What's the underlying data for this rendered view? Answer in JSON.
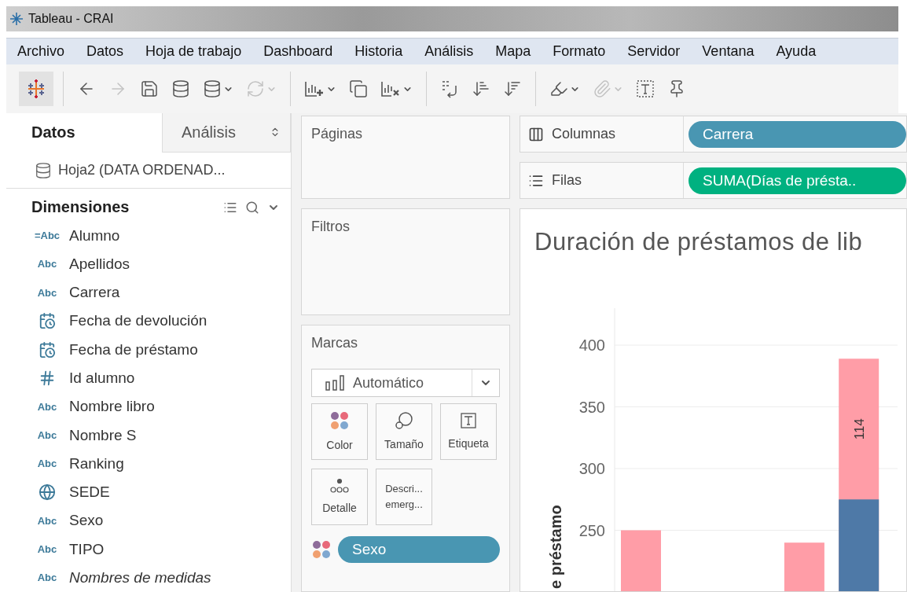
{
  "window": {
    "title": "Tableau - CRAI"
  },
  "menu": [
    "Archivo",
    "Datos",
    "Hoja de trabajo",
    "Dashboard",
    "Historia",
    "Análisis",
    "Mapa",
    "Formato",
    "Servidor",
    "Ventana",
    "Ayuda"
  ],
  "toolbar": [
    {
      "kind": "logo",
      "menu": false
    },
    {
      "kind": "sep"
    },
    {
      "kind": "back",
      "disabled": false,
      "menu": false
    },
    {
      "kind": "forward",
      "disabled": true,
      "menu": false
    },
    {
      "kind": "save",
      "disabled": false,
      "menu": false
    },
    {
      "kind": "new-source",
      "disabled": false,
      "menu": false
    },
    {
      "kind": "pause-source",
      "disabled": false,
      "menu": true
    },
    {
      "kind": "refresh",
      "disabled": true,
      "menu": true
    },
    {
      "kind": "sep"
    },
    {
      "kind": "new-sheet",
      "disabled": false,
      "menu": true
    },
    {
      "kind": "duplicate",
      "disabled": false,
      "menu": false
    },
    {
      "kind": "clear",
      "disabled": false,
      "menu": true
    },
    {
      "kind": "sep"
    },
    {
      "kind": "swap",
      "disabled": false,
      "menu": false
    },
    {
      "kind": "sort-asc",
      "disabled": false,
      "menu": false
    },
    {
      "kind": "sort-desc",
      "disabled": false,
      "menu": false
    },
    {
      "kind": "sep"
    },
    {
      "kind": "highlight",
      "disabled": false,
      "menu": true
    },
    {
      "kind": "attach",
      "disabled": true,
      "menu": true
    },
    {
      "kind": "text",
      "disabled": false,
      "menu": false
    },
    {
      "kind": "pin",
      "disabled": false,
      "menu": false
    }
  ],
  "side_tabs": [
    {
      "label": "Datos",
      "selected": true
    },
    {
      "label": "Análisis",
      "selected": false
    }
  ],
  "data_source": "Hoja2 (DATA ORDENAD...",
  "dimensions": {
    "title": "Dimensiones",
    "fields": [
      {
        "kind": "text",
        "type_label": "=Abc",
        "name": "Alumno"
      },
      {
        "kind": "text",
        "type_label": "Abc",
        "name": "Apellidos"
      },
      {
        "kind": "text",
        "type_label": "Abc",
        "name": "Carrera"
      },
      {
        "kind": "date",
        "name": "Fecha de devolución"
      },
      {
        "kind": "date",
        "name": "Fecha de préstamo"
      },
      {
        "kind": "number",
        "name": "Id alumno"
      },
      {
        "kind": "text",
        "type_label": "Abc",
        "name": "Nombre libro"
      },
      {
        "kind": "text",
        "type_label": "Abc",
        "name": "Nombre S"
      },
      {
        "kind": "text",
        "type_label": "Abc",
        "name": "Ranking"
      },
      {
        "kind": "geo",
        "name": "SEDE"
      },
      {
        "kind": "text",
        "type_label": "Abc",
        "name": "Sexo"
      },
      {
        "kind": "text",
        "type_label": "Abc",
        "name": "TIPO"
      },
      {
        "kind": "names",
        "type_label": "Abc",
        "name": "Nombres de medidas"
      }
    ]
  },
  "cards": {
    "pages": "Páginas",
    "filters": "Filtros",
    "marks": "Marcas"
  },
  "mark_type": "Automático",
  "mark_buttons": [
    {
      "kind": "color",
      "lines": [
        "Color"
      ]
    },
    {
      "kind": "size",
      "lines": [
        "Tamaño"
      ]
    },
    {
      "kind": "label",
      "lines": [
        "Etiqueta"
      ]
    },
    {
      "kind": "detail",
      "lines": [
        "Detalle"
      ]
    },
    {
      "kind": "tooltip",
      "lines": [
        "Descri...",
        "emerg..."
      ]
    }
  ],
  "mark_fields": [
    {
      "kind": "dimension",
      "label": "Sexo"
    }
  ],
  "shelves": [
    {
      "kind": "columns",
      "label": "Columnas",
      "pill": {
        "label": "Carrera",
        "kind": "dimension"
      }
    },
    {
      "kind": "rows",
      "label": "Filas",
      "pill": {
        "label": "SUMA(Días de présta..",
        "kind": "measure"
      }
    }
  ],
  "view": {
    "title": "Duración de préstamos de lib",
    "chart_data": {
      "type": "bar",
      "stacked": false,
      "grid": true,
      "ylabel": "e préstamo",
      "ylim": [
        200,
        430
      ],
      "yticks": [
        250,
        300,
        350,
        400
      ],
      "series": [
        {
          "color": "#ff9da7",
          "values": [
            250,
            null,
            null,
            240,
            389
          ]
        },
        {
          "color": "#4e79a7",
          "values": [
            null,
            null,
            null,
            null,
            275
          ]
        }
      ],
      "annotations": [
        "114"
      ]
    }
  }
}
